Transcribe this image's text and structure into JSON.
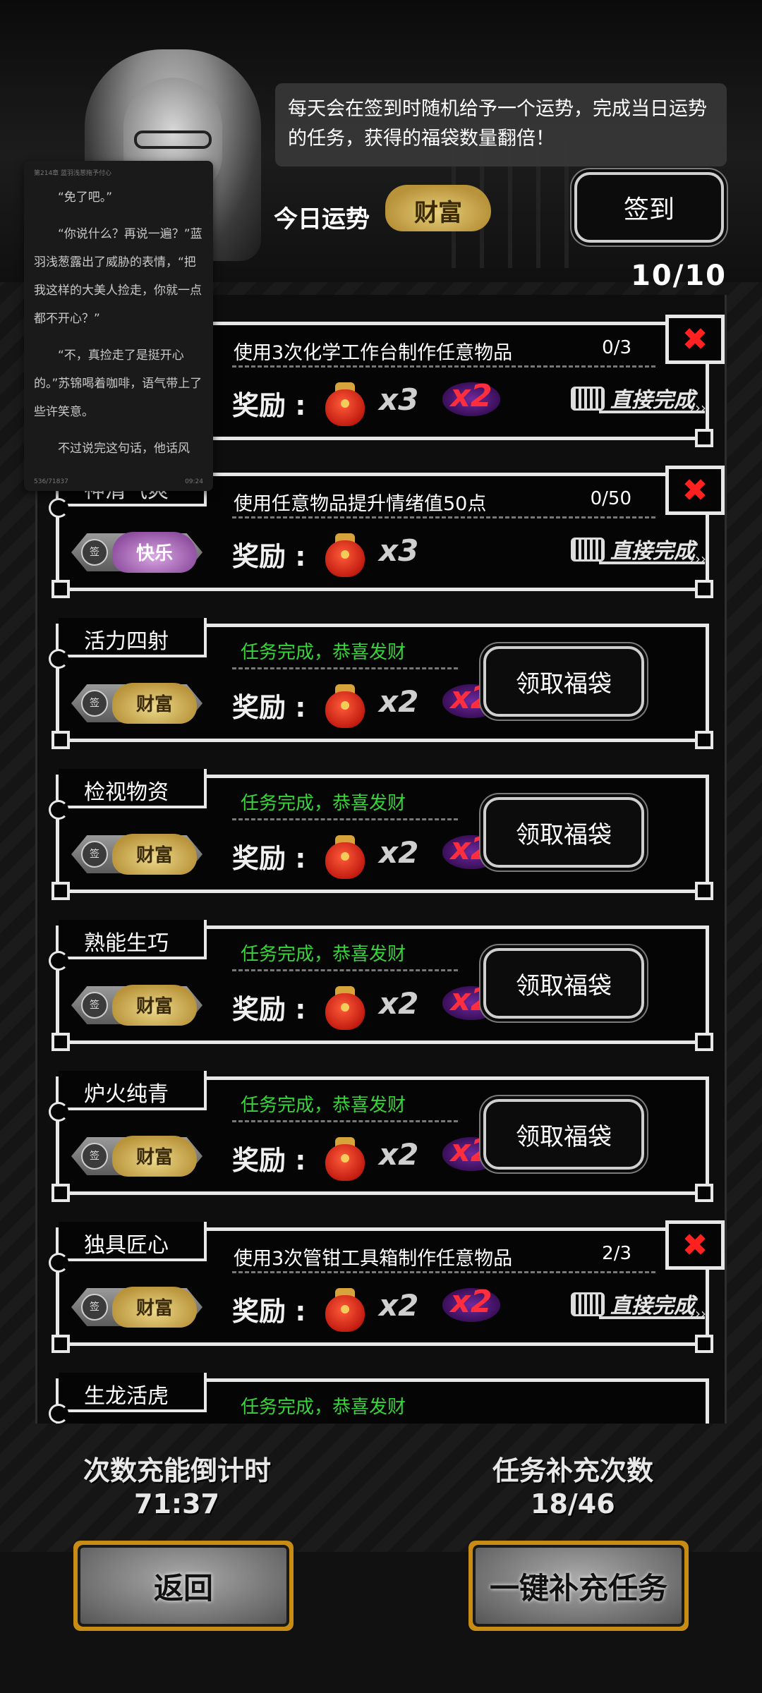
{
  "header": {
    "info_text": "每天会在签到时随机给予一个运势，完成当日运势的任务，获得的福袋数量翻倍！",
    "fortune_label": "今日运势",
    "fortune_value": "财富",
    "sign_button": "签到",
    "counter": "10/10"
  },
  "reader_overlay": {
    "header": "第214章 蓝羽浅葱拖予付心",
    "paragraphs": [
      "“免了吧。”",
      "“你说什么？再说一遍？”蓝羽浅葱露出了威胁的表情，“把我这样的大美人捡走，你就一点都不开心？”",
      "“不，真捡走了是挺开心的。”苏锦喝着咖啡，语气带上了些许笑意。",
      "不过说完这句话，他话风"
    ],
    "footer_left": "536/71837",
    "footer_right": "09:24"
  },
  "reward_label": "奖励",
  "quick_complete_label": "直接完成",
  "claim_button": "领取福袋",
  "done_text": "任务完成，恭喜发财",
  "tasks": [
    {
      "title": "",
      "desc": "使用3次化学工作台制作任意物品",
      "progress": "0/3",
      "tag": "",
      "multiplier": "x3",
      "double": "x2",
      "state": "pending"
    },
    {
      "title": "神清气爽",
      "desc": "使用任意物品提升情绪值50点",
      "progress": "0/50",
      "tag": "快乐",
      "multiplier": "x3",
      "double": "",
      "state": "pending"
    },
    {
      "title": "活力四射",
      "desc": "",
      "progress": "",
      "tag": "财富",
      "multiplier": "x2",
      "double": "x2",
      "state": "done"
    },
    {
      "title": "检视物资",
      "desc": "",
      "progress": "",
      "tag": "财富",
      "multiplier": "x2",
      "double": "x2",
      "state": "done"
    },
    {
      "title": "熟能生巧",
      "desc": "",
      "progress": "",
      "tag": "财富",
      "multiplier": "x2",
      "double": "x2",
      "state": "done"
    },
    {
      "title": "炉火纯青",
      "desc": "",
      "progress": "",
      "tag": "财富",
      "multiplier": "x2",
      "double": "x2",
      "state": "done"
    },
    {
      "title": "独具匠心",
      "desc": "使用3次管钳工具箱制作任意物品",
      "progress": "2/3",
      "tag": "财富",
      "multiplier": "x2",
      "double": "x2",
      "state": "pending"
    },
    {
      "title": "生龙活虎",
      "desc": "",
      "progress": "",
      "tag": "",
      "multiplier": "",
      "double": "",
      "state": "done"
    }
  ],
  "footer": {
    "countdown_label": "次数充能倒计时",
    "countdown_value": "71:37",
    "refill_label": "任务补充次数",
    "refill_value": "18/46",
    "back_button": "返回",
    "refill_button": "一键补充任务"
  },
  "colors": {
    "done_green": "#37d43a",
    "close_red": "#ff2020",
    "gold": "#c88c14"
  }
}
